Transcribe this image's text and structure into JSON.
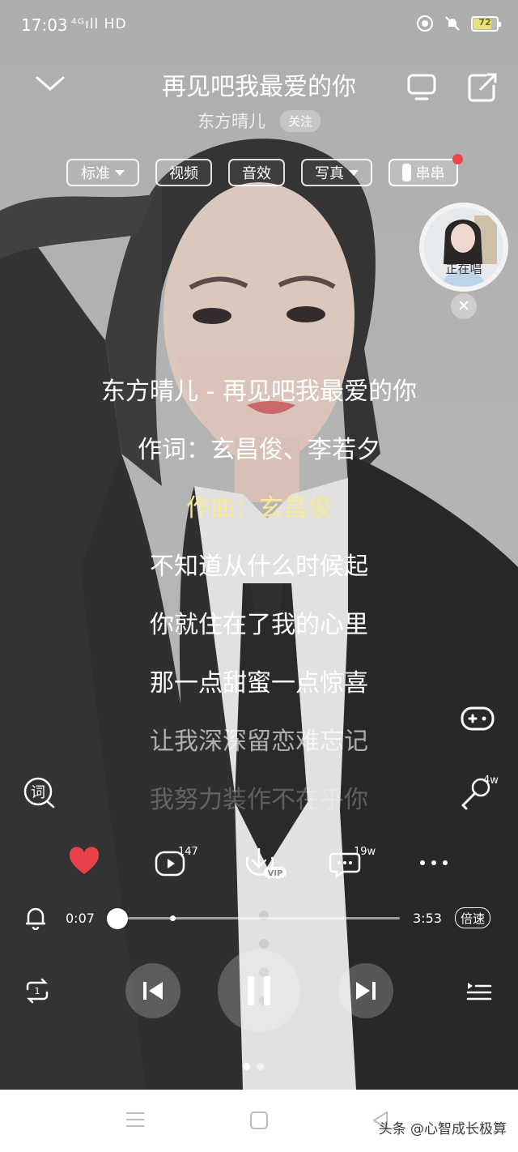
{
  "status_bar": {
    "time": "17:03",
    "network": "⁴ᴳıll HD",
    "battery": "72",
    "icons": [
      "record-icon",
      "mute-bell-icon",
      "battery-icon"
    ]
  },
  "header": {
    "title": "再见吧我最爱的你",
    "artist": "东方晴儿",
    "follow_label": "关注",
    "icons": [
      "chevron-down-icon",
      "tv-icon",
      "share-icon"
    ]
  },
  "chips": [
    {
      "label": "标准",
      "dropdown": true
    },
    {
      "label": "视频",
      "dropdown": false
    },
    {
      "label": "音效",
      "dropdown": false
    },
    {
      "label": "写真",
      "dropdown": true
    },
    {
      "label": "串串",
      "dropdown": false,
      "has_notification_dot": true
    }
  ],
  "singing_bubble": {
    "label": "正在唱"
  },
  "lyrics": [
    "东方晴儿 - 再见吧我最爱的你",
    "作词：玄昌俊、李若夕",
    "作曲：玄昌俊",
    "不知道从什么时候起",
    "你就住在了我的心里",
    "那一点甜蜜一点惊喜",
    "让我深深留恋难忘记",
    "我努力装作不在乎你"
  ],
  "active_lyric_index": 2,
  "side_icons": {
    "lyrics_icon": "词",
    "game_icon": "gamepad-icon",
    "karaoke_count": "4w"
  },
  "actions": {
    "liked": true,
    "video_count": "147",
    "download_badge": "VIP",
    "comment_count": "19w",
    "colors": {
      "like": "#e8424a"
    }
  },
  "progress": {
    "current": "0:07",
    "total": "3:53",
    "played_fraction": 0.03,
    "buffered_fraction": 0.22,
    "speed_label": "倍速"
  },
  "player": {
    "state": "playing",
    "page_index": 0,
    "page_count": 2
  },
  "watermark": "头条 @心智成长极算"
}
